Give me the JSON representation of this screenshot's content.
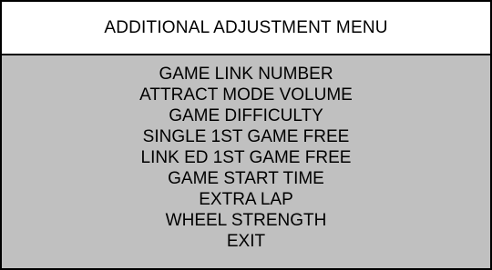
{
  "header": {
    "title": "ADDITIONAL ADJUSTMENT MENU"
  },
  "menu": {
    "items": [
      {
        "label": "GAME LINK NUMBER"
      },
      {
        "label": "ATTRACT MODE VOLUME"
      },
      {
        "label": "GAME DIFFICULTY"
      },
      {
        "label": "SINGLE 1ST GAME FREE"
      },
      {
        "label": "LINK ED 1ST GAME FREE"
      },
      {
        "label": "GAME START TIME"
      },
      {
        "label": "EXTRA LAP"
      },
      {
        "label": "WHEEL STRENGTH"
      },
      {
        "label": "EXIT"
      }
    ]
  },
  "colors": {
    "panel_background": "#c0c0c0",
    "header_background": "#ffffff",
    "border": "#000000",
    "text": "#000000"
  }
}
